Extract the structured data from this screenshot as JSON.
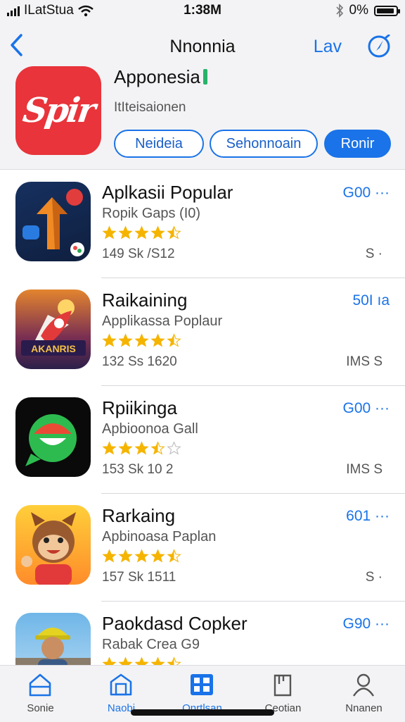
{
  "status": {
    "carrier": "ILatStua",
    "time": "1:38M",
    "battery": "0%"
  },
  "header": {
    "title": "Nnonnia",
    "link": "Lav"
  },
  "app": {
    "name": "Apponesia",
    "subtitle": "ItIteisaionen",
    "icon_text": "Spir",
    "buttons": [
      "Neideia",
      "Sehonnoain",
      "Ronir"
    ]
  },
  "apps": [
    {
      "title": "Aplkasii Popular",
      "subtitle": "Ropik Gaps (I0)",
      "rating": 4.5,
      "stat": "149 Sk /S12",
      "price": "G00 ···",
      "meta": "S ·",
      "icon": "arrow-up-icon"
    },
    {
      "title": "Raikaining",
      "subtitle": "Applikassa Poplaur",
      "rating": 4.5,
      "stat": "132 Ss 1620",
      "price": "50I ıa",
      "meta": "IMS S",
      "icon": "rocket-icon"
    },
    {
      "title": "Rpiikinga",
      "subtitle": "Apbioonoa Gall",
      "rating": 3.5,
      "stat": "153 Sk 10 2",
      "price": "G00 ···",
      "meta": "IMS S",
      "icon": "chat-bubble-icon"
    },
    {
      "title": "Rarkaing",
      "subtitle": "Apbinoasa Paplan",
      "rating": 4.5,
      "stat": "157 Sk 1511",
      "price": "601 ···",
      "meta": "S ·",
      "icon": "cartoon-character-icon"
    },
    {
      "title": "Paokdasd Copker",
      "subtitle": "Rabak Crea G9",
      "rating": 4.5,
      "stat": "",
      "price": "G90 ···",
      "meta": "",
      "icon": "worker-avatar-icon"
    }
  ],
  "tabs": [
    {
      "label": "Sonie",
      "icon": "home-icon"
    },
    {
      "label": "Naobi",
      "icon": "store-icon"
    },
    {
      "label": "Onrtlsan",
      "icon": "grid-icon"
    },
    {
      "label": "Ceotian",
      "icon": "document-icon"
    },
    {
      "label": "Nnanen",
      "icon": "person-icon"
    }
  ],
  "colors": {
    "accent": "#1a73e8",
    "brand_red": "#e8343a",
    "star": "#f5b400",
    "header_bg": "#f3f3f5"
  }
}
